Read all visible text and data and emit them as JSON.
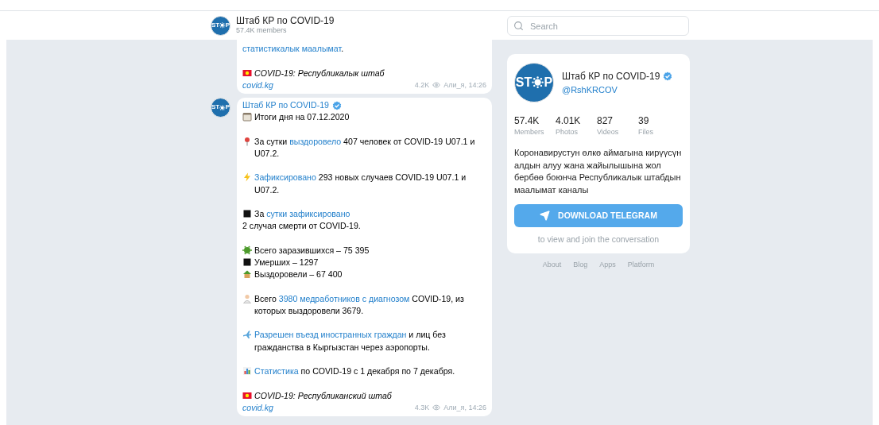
{
  "header": {
    "avatar": [
      "ST",
      "P"
    ],
    "title": "Штаб КР по COVID-19",
    "subtitle": "57.4K members"
  },
  "search": {
    "placeholder": "Search"
  },
  "messages": [
    {
      "paragraphs": [
        [
          {
            "segments": [
              {
                "text": "статистикалык маалымат",
                "link": true
              },
              {
                "text": ".",
                "link": false
              }
            ]
          }
        ],
        [
          {
            "segments": [
              {
                "text": "COVID-19: Республикалык штаб",
                "link": false,
                "italic": true
              }
            ]
          },
          {
            "segments": [
              {
                "text": "covid.kg",
                "link": true,
                "italic": true
              }
            ]
          }
        ]
      ],
      "views": "4.2K",
      "signature": "Али_я, 14:26"
    },
    {
      "avatar": [
        "ST",
        "P"
      ],
      "author": "Штаб КР по COVID-19",
      "verified": true,
      "paragraphs": [
        [
          {
            "segments": [
              {
                "text": "Итоги дня на 07.12.2020",
                "link": false
              }
            ]
          }
        ],
        [
          {
            "segments": [
              {
                "text": "За сутки ",
                "link": false
              },
              {
                "text": "выздоровело",
                "link": true
              },
              {
                "text": " 407 человек от COVID-19 U07.1 и U07.2.",
                "link": false
              }
            ]
          }
        ],
        [
          {
            "segments": [
              {
                "text": "Зафиксировано",
                "link": true
              },
              {
                "text": " 293 новых случаев COVID-19 U07.1 и U07.2.",
                "link": false
              }
            ]
          }
        ],
        [
          {
            "segments": [
              {
                "text": "За ",
                "link": false
              },
              {
                "text": "сутки зафиксировано",
                "link": true
              }
            ]
          },
          {
            "segments": [
              {
                "text": "2 случая смерти от COVID-19.",
                "link": false
              }
            ]
          }
        ],
        [
          {
            "segments": [
              {
                "text": "Всего заразившихся – 75 395",
                "link": false
              }
            ]
          },
          {
            "segments": [
              {
                "text": "Умерших – 1297",
                "link": false
              }
            ]
          },
          {
            "segments": [
              {
                "text": "Выздоровели – 67 400",
                "link": false
              }
            ]
          }
        ],
        [
          {
            "segments": [
              {
                "text": "Всего ",
                "link": false
              },
              {
                "text": "3980 медработников с диагнозом",
                "link": true
              },
              {
                "text": " COVID-19, из которых выздоровели 3679.",
                "link": false
              }
            ]
          }
        ],
        [
          {
            "segments": [
              {
                "text": "Разрешен въезд иностранных граждан",
                "link": true
              },
              {
                "text": " и лиц без гражданства в Кыргызстан через аэропорты.",
                "link": false
              }
            ]
          }
        ],
        [
          {
            "segments": [
              {
                "text": "Статистика",
                "link": true
              },
              {
                "text": " по COVID-19 с 1 декабря по 7 декабря.",
                "link": false
              }
            ]
          }
        ],
        [
          {
            "segments": [
              {
                "text": "COVID-19: Республиканский штаб",
                "link": false,
                "italic": true
              }
            ]
          },
          {
            "segments": [
              {
                "text": "covid.kg",
                "link": true,
                "italic": true
              }
            ]
          }
        ]
      ],
      "views": "4.3K",
      "signature": "Али_я, 14:26"
    }
  ],
  "channel": {
    "avatar": [
      "ST",
      "P"
    ],
    "name": "Штаб КР по COVID-19",
    "verified": true,
    "handle": "@RshKRCOV",
    "stats": [
      {
        "value": "57.4K",
        "label": "Members"
      },
      {
        "value": "4.01K",
        "label": "Photos"
      },
      {
        "value": "827",
        "label": "Videos"
      },
      {
        "value": "39",
        "label": "Files"
      }
    ],
    "description": "Коронавирустун өлкө аймагына кирүүсүн алдын алуу жана жайылышына жол бербөө боюнча Республикалык штабдын маалымат каналы",
    "button": "DOWNLOAD TELEGRAM",
    "hint": "to view and join the conversation"
  },
  "footer_links": [
    "About",
    "Blog",
    "Apps",
    "Platform"
  ]
}
